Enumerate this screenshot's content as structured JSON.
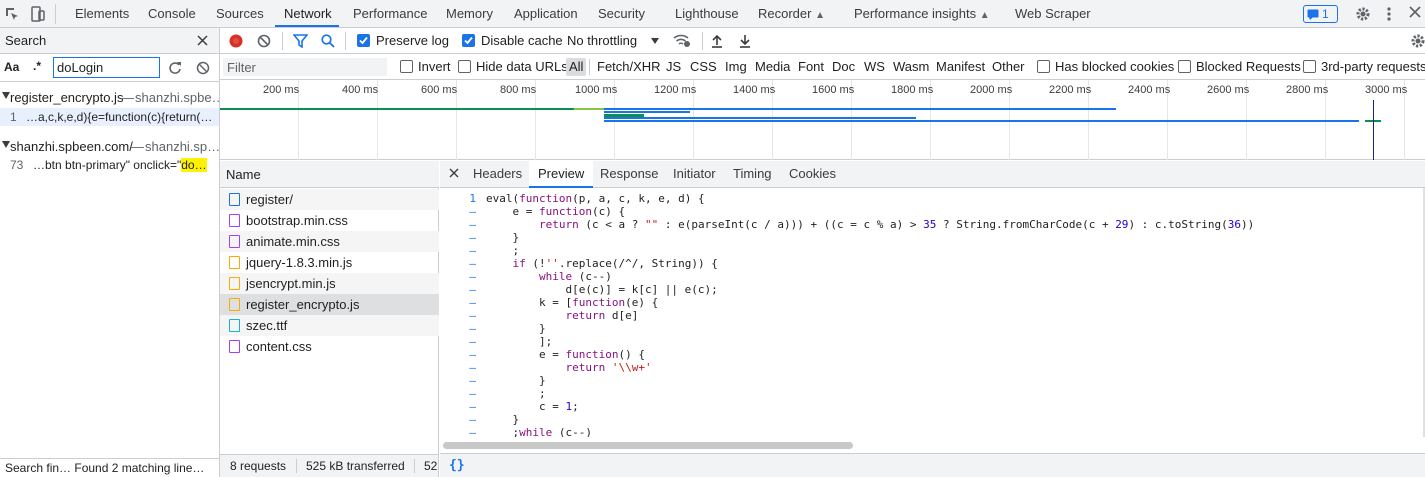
{
  "toolbar": {
    "tabs": [
      "Elements",
      "Console",
      "Sources",
      "Network",
      "Performance",
      "Memory",
      "Application",
      "Security",
      "Lighthouse",
      "Recorder",
      "Performance insights",
      "Web Scraper"
    ],
    "active_tab": "Network",
    "issues_count": "1"
  },
  "search": {
    "title": "Search",
    "case_label": "Aa",
    "regex_label": ".*",
    "query": "doLogin",
    "results": [
      {
        "file": "register_encrypto.js",
        "origin": "shanzhi.spbe…",
        "line_no": "1",
        "pre": "…a,c,k,e,d){e=function(c){return(…",
        "match": ""
      },
      {
        "file": "shanzhi.spbeen.com/",
        "origin": "shanzhi.sp…",
        "line_no": "73",
        "pre": "…btn btn-primary\" onclick=\"",
        "match": "do…"
      }
    ],
    "status": "Search fin…  Found 2 matching line…"
  },
  "network": {
    "preserve_log": "Preserve log",
    "disable_cache": "Disable cache",
    "throttling": "No throttling",
    "filter_placeholder": "Filter",
    "invert": "Invert",
    "hide_data_urls": "Hide data URLs",
    "types": [
      "All",
      "Fetch/XHR",
      "JS",
      "CSS",
      "Img",
      "Media",
      "Font",
      "Doc",
      "WS",
      "Wasm",
      "Manifest",
      "Other"
    ],
    "active_type": "All",
    "has_blocked_cookies": "Has blocked cookies",
    "blocked_requests": "Blocked Requests",
    "third_party": "3rd-party requests",
    "ticks": [
      "200 ms",
      "400 ms",
      "600 ms",
      "800 ms",
      "1000 ms",
      "1200 ms",
      "1400 ms",
      "1600 ms",
      "1800 ms",
      "2000 ms",
      "2200 ms",
      "2400 ms",
      "2600 ms",
      "2800 ms",
      "3000 ms"
    ]
  },
  "requests": {
    "header": "Name",
    "items": [
      {
        "name": "register/",
        "type": "doc",
        "color": "#1a73e8"
      },
      {
        "name": "bootstrap.min.css",
        "type": "css",
        "color": "#a142f4"
      },
      {
        "name": "animate.min.css",
        "type": "css",
        "color": "#a142f4"
      },
      {
        "name": "jquery-1.8.3.min.js",
        "type": "js",
        "color": "#f9ab00"
      },
      {
        "name": "jsencrypt.min.js",
        "type": "js",
        "color": "#f9ab00"
      },
      {
        "name": "register_encrypto.js",
        "type": "js",
        "color": "#f9ab00"
      },
      {
        "name": "szec.ttf",
        "type": "font",
        "color": "#12b5cb"
      },
      {
        "name": "content.css",
        "type": "css",
        "color": "#a142f4"
      }
    ],
    "selected": "register_encrypto.js"
  },
  "status_bar": {
    "requests": "8 requests",
    "transferred": "525 kB transferred",
    "more": "52"
  },
  "preview": {
    "tabs": [
      "Headers",
      "Preview",
      "Response",
      "Initiator",
      "Timing",
      "Cookies"
    ],
    "active_tab": "Preview",
    "footer_icon": "{}",
    "lines": [
      {
        "no": "1",
        "text": "eval(function(p, a, c, k, e, d) {"
      },
      {
        "no": "–",
        "text": "    e = function(c) {"
      },
      {
        "no": "–",
        "text": "        return (c < a ? \"\" : e(parseInt(c / a))) + ((c = c % a) > 35 ? String.fromCharCode(c + 29) : c.toString(36))"
      },
      {
        "no": "–",
        "text": "    }"
      },
      {
        "no": "–",
        "text": "    ;"
      },
      {
        "no": "–",
        "text": "    if (!''.replace(/^/, String)) {"
      },
      {
        "no": "–",
        "text": "        while (c--)"
      },
      {
        "no": "–",
        "text": "            d[e(c)] = k[c] || e(c);"
      },
      {
        "no": "–",
        "text": "        k = [function(e) {"
      },
      {
        "no": "–",
        "text": "            return d[e]"
      },
      {
        "no": "–",
        "text": "        }"
      },
      {
        "no": "–",
        "text": "        ];"
      },
      {
        "no": "–",
        "text": "        e = function() {"
      },
      {
        "no": "–",
        "text": "            return '\\\\w+'"
      },
      {
        "no": "–",
        "text": "        }"
      },
      {
        "no": "–",
        "text": "        ;"
      },
      {
        "no": "–",
        "text": "        c = 1;"
      },
      {
        "no": "–",
        "text": "    }"
      },
      {
        "no": "–",
        "text": "    ;while (c--)"
      }
    ]
  }
}
